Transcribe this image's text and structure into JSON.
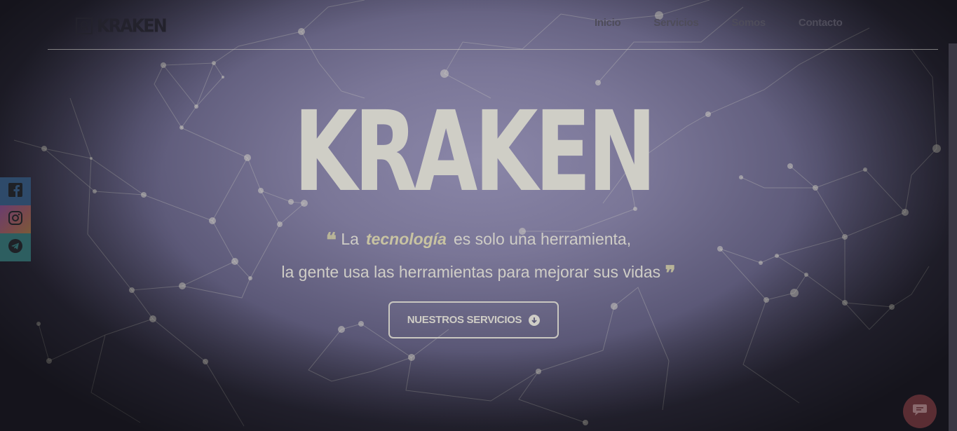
{
  "brand": {
    "name": "KRAKEN",
    "icon": "kraken-logo-icon"
  },
  "nav": {
    "items": [
      {
        "label": "Inicio"
      },
      {
        "label": "Servicios"
      },
      {
        "label": "Somos"
      },
      {
        "label": "Contacto"
      }
    ]
  },
  "hero": {
    "title": "KRAKEN",
    "quote_part1": "La",
    "quote_emphasis": "tecnología",
    "quote_part2": "es solo una herramienta,",
    "quote_line2": "la gente usa las herramientas para mejorar sus vidas",
    "open_quote": "❝",
    "close_quote": "❞",
    "cta_label": "NUESTROS SERVICIOS",
    "cta_icon": "arrow-down-circle-icon"
  },
  "social": [
    {
      "name": "facebook",
      "icon": "facebook-icon",
      "color": "#2e4a6a"
    },
    {
      "name": "instagram",
      "icon": "instagram-icon",
      "color": "#6a3d6e"
    },
    {
      "name": "telegram",
      "icon": "telegram-icon",
      "color": "#2d5e60"
    }
  ],
  "chat": {
    "icon": "chat-bubble-icon",
    "color": "#5a2d33"
  },
  "colors": {
    "background": "#6e6a8a",
    "title": "#cfcec6",
    "accent": "#c8c3a2"
  }
}
